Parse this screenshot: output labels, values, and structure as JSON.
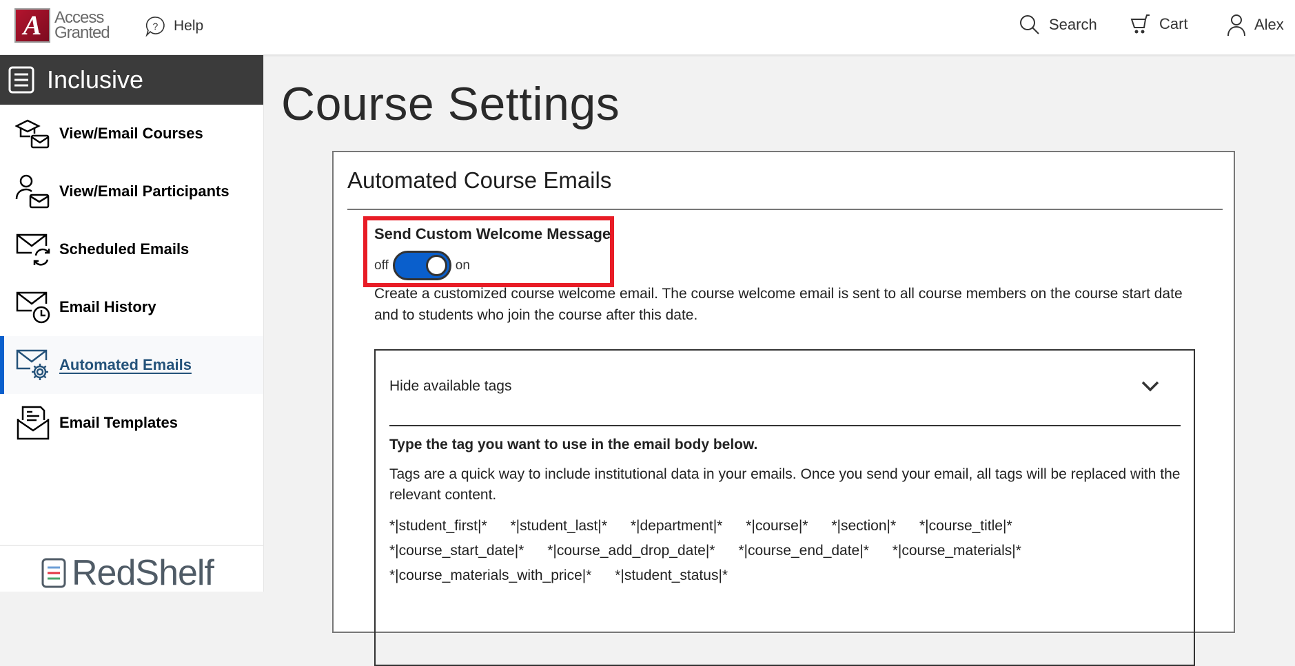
{
  "header": {
    "logo_line1": "Access",
    "logo_line2": "Granted",
    "logo_letter": "A",
    "help_label": "Help",
    "search_label": "Search",
    "cart_label": "Cart",
    "user_label": "Alex"
  },
  "sidebar": {
    "title": "Inclusive",
    "items": [
      {
        "label": "View/Email Courses",
        "icon": "graduation-cap-mail-icon",
        "active": false
      },
      {
        "label": "View/Email Participants",
        "icon": "person-mail-icon",
        "active": false
      },
      {
        "label": "Scheduled Emails",
        "icon": "mail-refresh-icon",
        "active": false
      },
      {
        "label": "Email History",
        "icon": "mail-clock-icon",
        "active": false
      },
      {
        "label": "Automated Emails",
        "icon": "mail-gear-icon",
        "active": true
      },
      {
        "label": "Email Templates",
        "icon": "mail-document-icon",
        "active": false
      }
    ],
    "footer_logo": "RedShelf"
  },
  "main": {
    "page_title": "Course Settings",
    "card": {
      "title": "Automated Course Emails",
      "toggle": {
        "label": "Send Custom Welcome Message",
        "off_label": "off",
        "on_label": "on",
        "state": "on"
      },
      "description": "Create a customized course welcome email. The course welcome email is sent to all course members on the course start date and to students who join the course after this date.",
      "tags_panel": {
        "toggle_label": "Hide available tags",
        "instruction": "Type the tag you want to use in the email body below.",
        "help_text": "Tags are a quick way to include institutional data in your emails. Once you send your email, all tags will be replaced with the relevant content.",
        "tags": [
          "*|student_first|*",
          "*|student_last|*",
          "*|department|*",
          "*|course|*",
          "*|section|*",
          "*|course_title|*",
          "*|course_start_date|*",
          "*|course_add_drop_date|*",
          "*|course_end_date|*",
          "*|course_materials|*",
          "*|course_materials_with_price|*",
          "*|student_status|*"
        ]
      }
    }
  },
  "colors": {
    "accent": "#0a5fcc",
    "highlight": "#e81c26",
    "sidebar_header": "#3b3b3b",
    "active_text": "#24527a",
    "brand": "#9e1b32"
  }
}
